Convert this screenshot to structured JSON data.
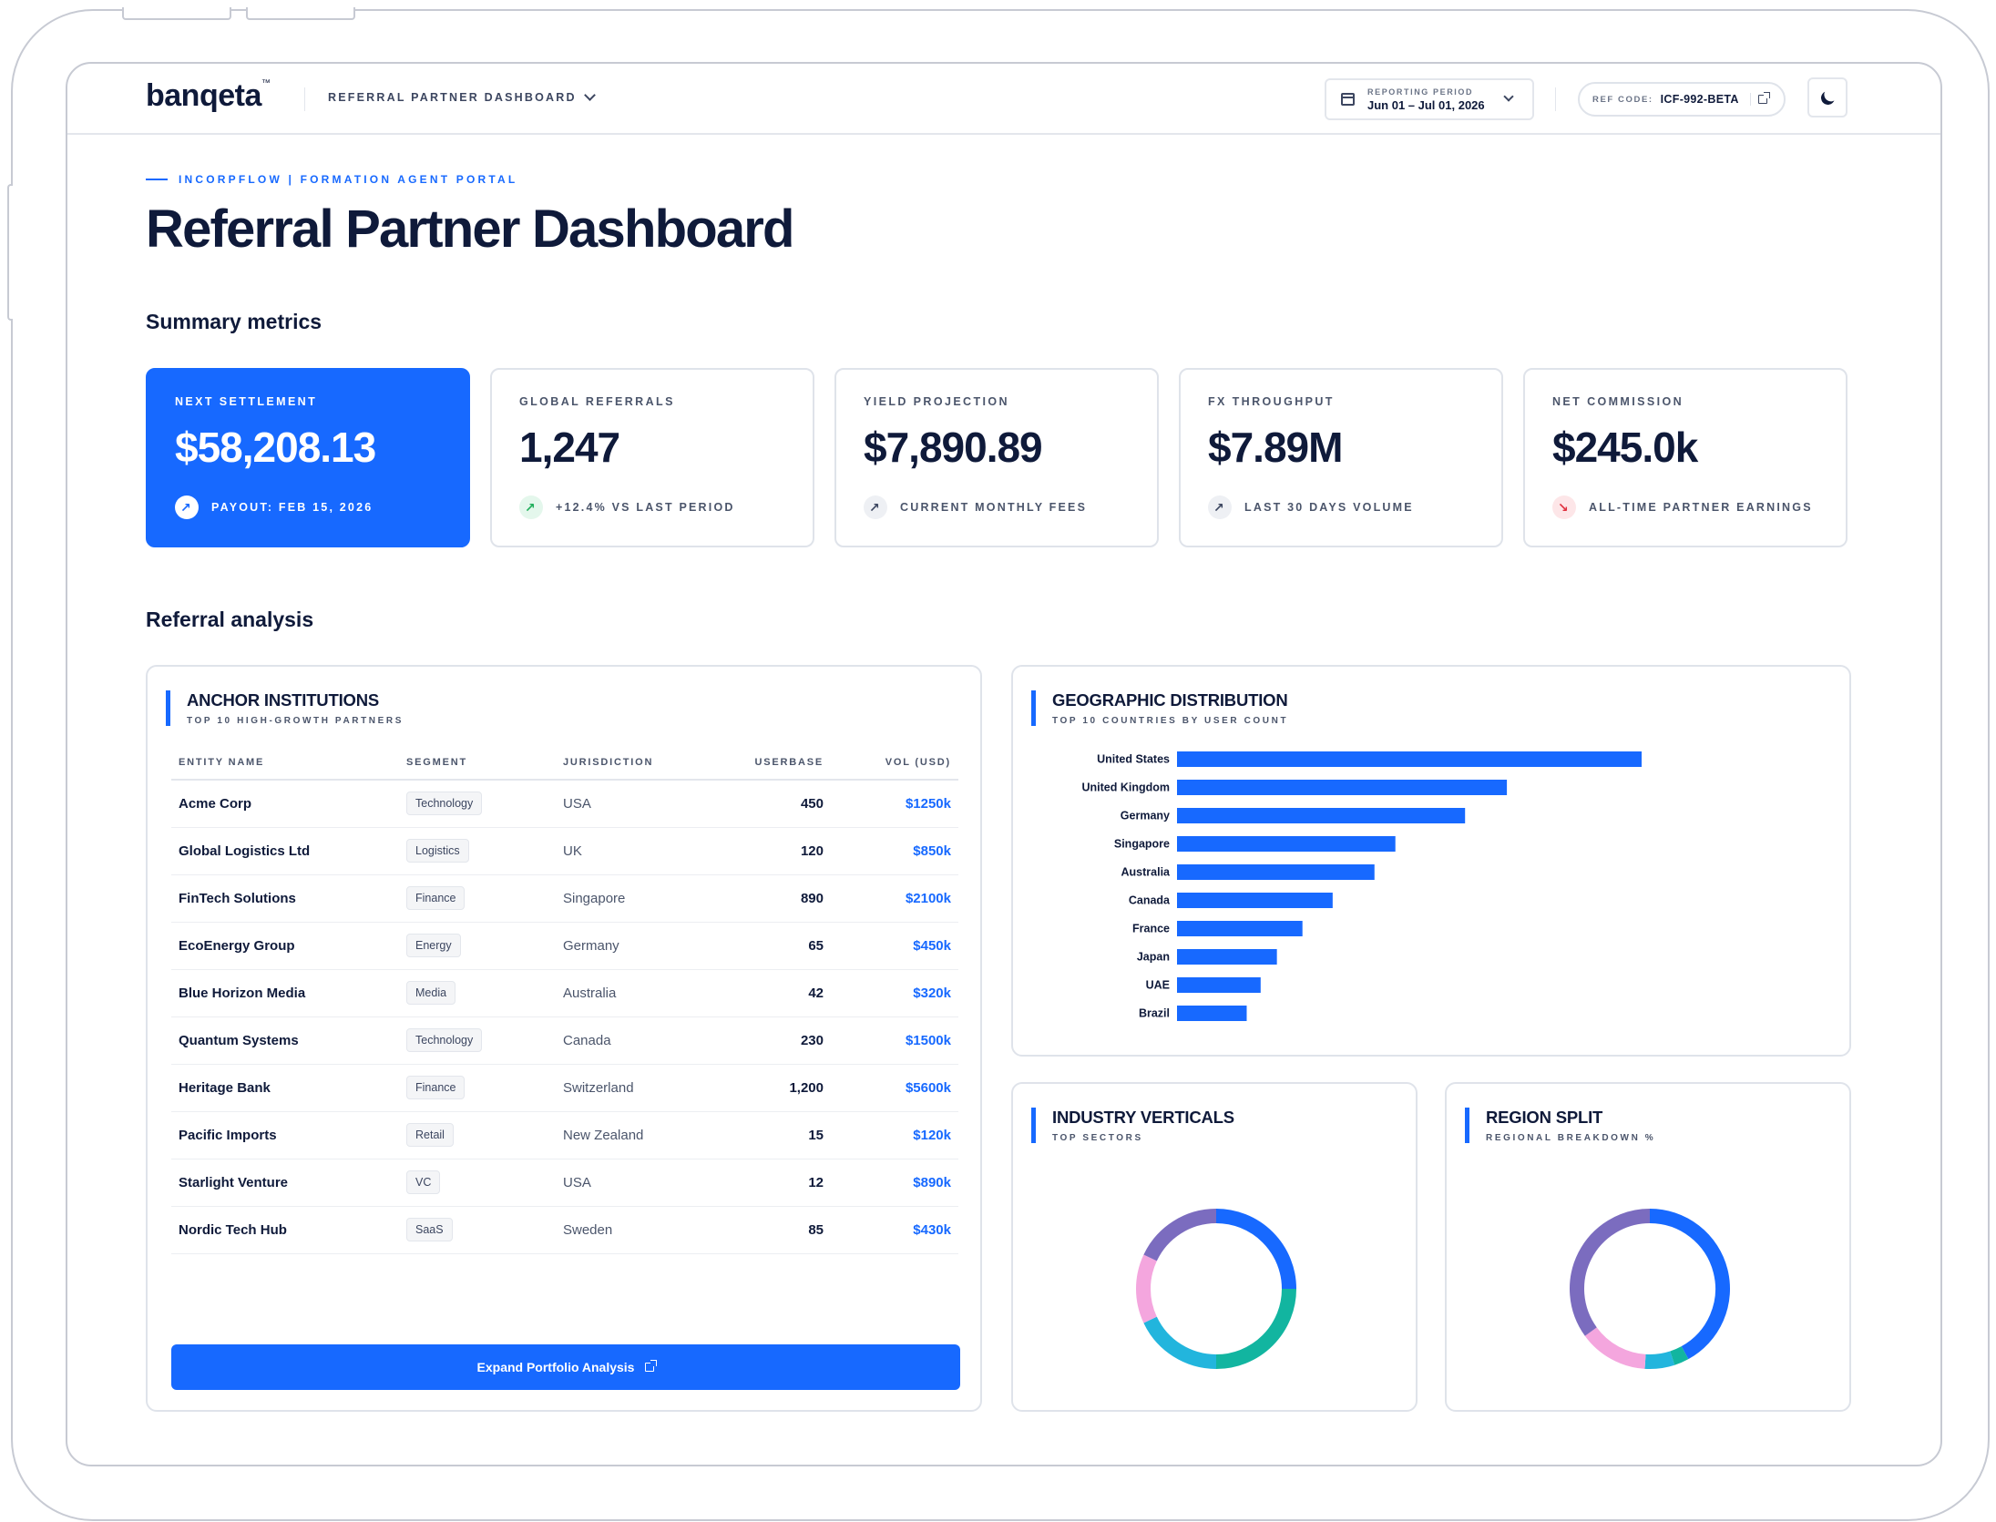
{
  "brand": {
    "logo_text": "banqeta",
    "logo_tm": "™"
  },
  "header": {
    "dashboard_select": "REFERRAL PARTNER DASHBOARD",
    "period_label": "REPORTING PERIOD",
    "period_value": "Jun 01 – Jul 01, 2026",
    "ref_label": "REF CODE:",
    "ref_value": "ICF-992-BETA"
  },
  "page": {
    "eyebrow": "INCORPFLOW | FORMATION AGENT PORTAL",
    "title": "Referral Partner Dashboard",
    "summary_heading": "Summary metrics",
    "analysis_heading": "Referral analysis"
  },
  "kpis": [
    {
      "label": "NEXT SETTLEMENT",
      "value": "$58,208.13",
      "note": "PAYOUT: FEB 15, 2026",
      "icon": "trend-up-icon"
    },
    {
      "label": "GLOBAL REFERRALS",
      "value": "1,247",
      "note": "+12.4% VS LAST PERIOD",
      "icon": "arrow-up-right-icon"
    },
    {
      "label": "YIELD PROJECTION",
      "value": "$7,890.89",
      "note": "CURRENT MONTHLY FEES",
      "icon": "trend-up-icon"
    },
    {
      "label": "FX THROUGHPUT",
      "value": "$7.89M",
      "note": "LAST 30 DAYS VOLUME",
      "icon": "trend-up-icon"
    },
    {
      "label": "NET COMMISSION",
      "value": "$245.0k",
      "note": "ALL-TIME PARTNER EARNINGS",
      "icon": "arrow-down-right-icon"
    }
  ],
  "anchor": {
    "title": "ANCHOR INSTITUTIONS",
    "subtitle": "TOP 10 HIGH-GROWTH PARTNERS",
    "columns": [
      "ENTITY NAME",
      "SEGMENT",
      "JURISDICTION",
      "USERBASE",
      "VOL (USD)"
    ],
    "rows": [
      {
        "name": "Acme Corp",
        "segment": "Technology",
        "jurisdiction": "USA",
        "userbase": "450",
        "vol": "$1250k"
      },
      {
        "name": "Global Logistics Ltd",
        "segment": "Logistics",
        "jurisdiction": "UK",
        "userbase": "120",
        "vol": "$850k"
      },
      {
        "name": "FinTech Solutions",
        "segment": "Finance",
        "jurisdiction": "Singapore",
        "userbase": "890",
        "vol": "$2100k"
      },
      {
        "name": "EcoEnergy Group",
        "segment": "Energy",
        "jurisdiction": "Germany",
        "userbase": "65",
        "vol": "$450k"
      },
      {
        "name": "Blue Horizon Media",
        "segment": "Media",
        "jurisdiction": "Australia",
        "userbase": "42",
        "vol": "$320k"
      },
      {
        "name": "Quantum Systems",
        "segment": "Technology",
        "jurisdiction": "Canada",
        "userbase": "230",
        "vol": "$1500k"
      },
      {
        "name": "Heritage Bank",
        "segment": "Finance",
        "jurisdiction": "Switzerland",
        "userbase": "1,200",
        "vol": "$5600k"
      },
      {
        "name": "Pacific Imports",
        "segment": "Retail",
        "jurisdiction": "New Zealand",
        "userbase": "15",
        "vol": "$120k"
      },
      {
        "name": "Starlight Venture",
        "segment": "VC",
        "jurisdiction": "USA",
        "userbase": "12",
        "vol": "$890k"
      },
      {
        "name": "Nordic Tech Hub",
        "segment": "SaaS",
        "jurisdiction": "Sweden",
        "userbase": "85",
        "vol": "$430k"
      }
    ],
    "button_label": "Expand Portfolio Analysis"
  },
  "geo": {
    "title": "GEOGRAPHIC DISTRIBUTION",
    "subtitle": "TOP 10 COUNTRIES BY USER COUNT"
  },
  "industry": {
    "title": "INDUSTRY VERTICALS",
    "subtitle": "TOP SECTORS"
  },
  "region": {
    "title": "REGION SPLIT",
    "subtitle": "REGIONAL BREAKDOWN %"
  },
  "colors": {
    "accent": "#1769ff",
    "teal": "#12b5a0",
    "cyan": "#22b5dd",
    "pink": "#f4a6de",
    "purple": "#7b6cbf"
  },
  "chart_data": [
    {
      "type": "bar",
      "orientation": "horizontal",
      "categories": [
        "United States",
        "United Kingdom",
        "Germany",
        "Singapore",
        "Australia",
        "Canada",
        "France",
        "Japan",
        "UAE",
        "Brazil"
      ],
      "values": [
        1000,
        710,
        620,
        470,
        425,
        335,
        270,
        215,
        180,
        150
      ],
      "grid": false
    },
    {
      "type": "pie",
      "donut": true,
      "values": [
        25,
        25,
        18,
        14,
        18
      ],
      "colors": [
        "#1769ff",
        "#12b5a0",
        "#22b5dd",
        "#f4a6de",
        "#7b6cbf"
      ]
    },
    {
      "type": "pie",
      "donut": true,
      "values": [
        42,
        3,
        6,
        14,
        35
      ],
      "colors": [
        "#1769ff",
        "#12b5a0",
        "#22b5dd",
        "#f4a6de",
        "#7b6cbf"
      ]
    }
  ]
}
